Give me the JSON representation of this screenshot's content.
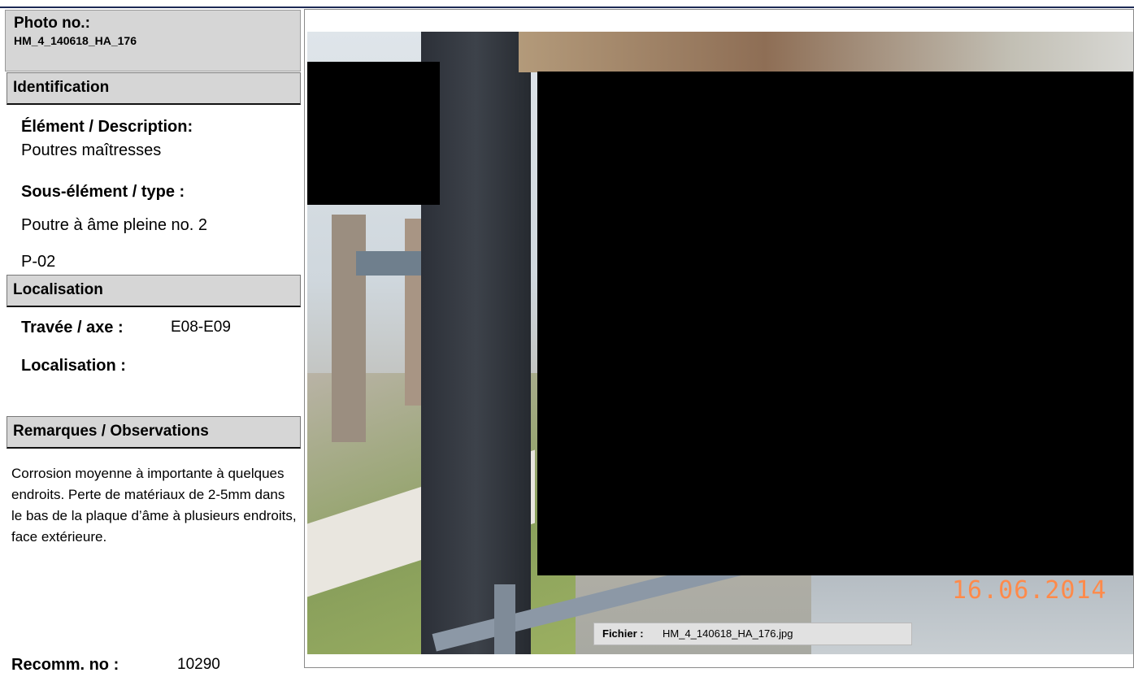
{
  "photo": {
    "label": "Photo no.:",
    "number": "HM_4_140618_HA_176",
    "date_stamp": "16.06.2014",
    "file_label": "Fichier :",
    "file_name": "HM_4_140618_HA_176.jpg"
  },
  "identification": {
    "title": "Identification",
    "element_label": "Élément / Description:",
    "element_value": "Poutres maîtresses",
    "subelement_label": "Sous-élément / type :",
    "subelement_value": "Poutre à âme pleine no. 2",
    "code": "P-02"
  },
  "localisation": {
    "title": "Localisation",
    "travee_label": "Travée / axe :",
    "travee_value": "E08-E09",
    "loc_label": "Localisation :",
    "loc_value": ""
  },
  "remarks": {
    "title": "Remarques / Observations",
    "text": "Corrosion moyenne à importante à quelques endroits. Perte de matériaux de 2-5mm dans le bas de la plaque d’âme à plusieurs endroits, face extérieure."
  },
  "recommendation": {
    "label": "Recomm. no :",
    "value": "10290"
  }
}
